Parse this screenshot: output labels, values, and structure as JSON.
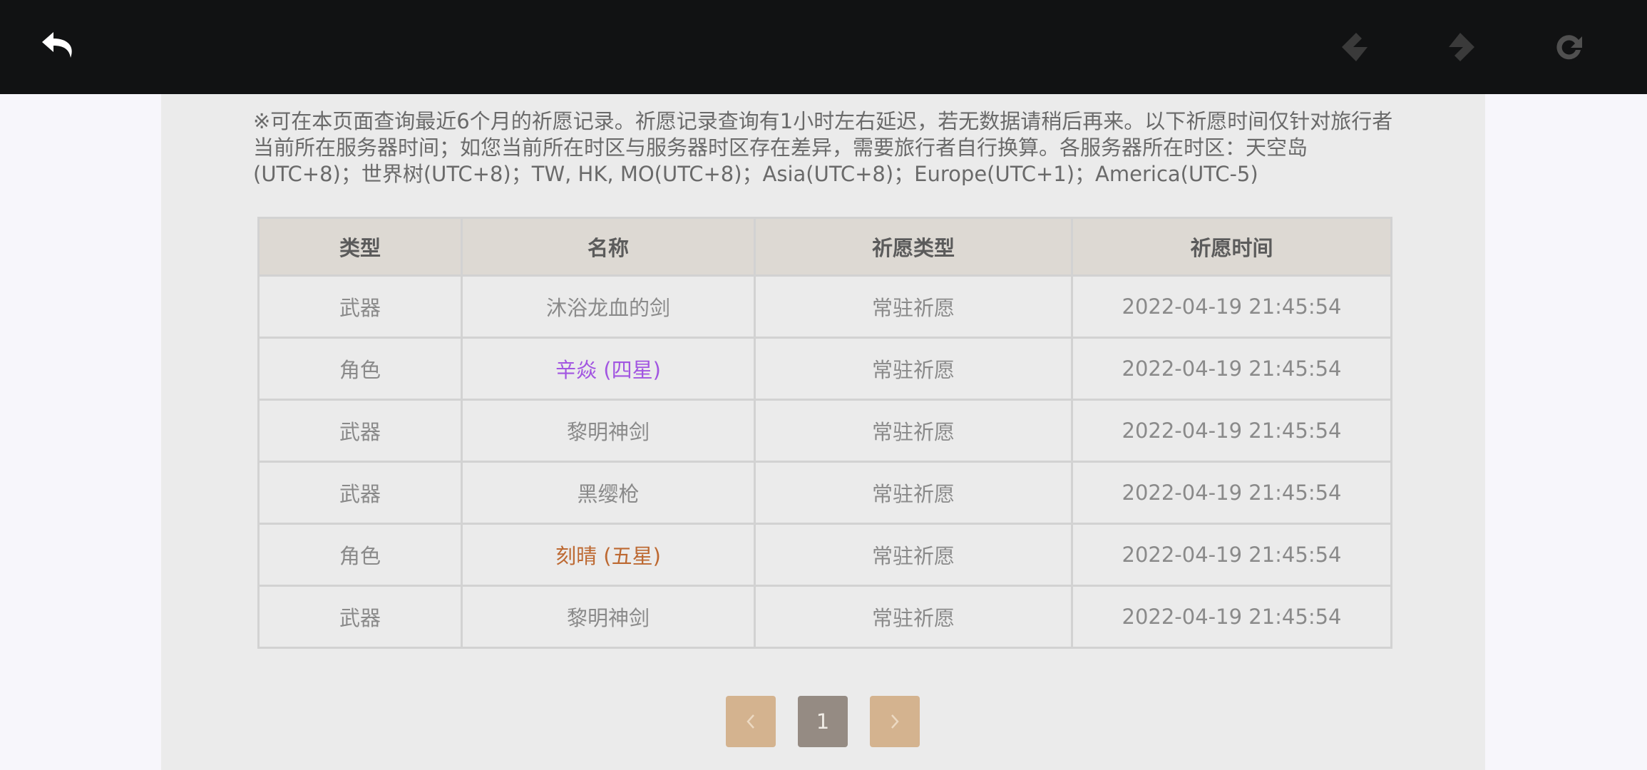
{
  "toolbar": {
    "back_icon": "undo-arrow-icon",
    "prev_icon": "back-diamond-icon",
    "next_icon": "forward-diamond-icon",
    "reload_icon": "reload-icon"
  },
  "notice": "※可在本页面查询最近6个月的祈愿记录。祈愿记录查询有1小时左右延迟，若无数据请稍后再来。以下祈愿时间仅针对旅行者当前所在服务器时间；如您当前所在时区与服务器时区存在差异，需要旅行者自行换算。各服务器所在时区：天空岛(UTC+8)；世界树(UTC+8)；TW, HK, MO(UTC+8)；Asia(UTC+8)；Europe(UTC+1)；America(UTC-5)",
  "table": {
    "headers": [
      "类型",
      "名称",
      "祈愿类型",
      "祈愿时间"
    ],
    "rows": [
      [
        "武器",
        "沐浴龙血的剑",
        "常驻祈愿",
        "2022-04-19 21:45:54"
      ],
      [
        "角色",
        "辛焱 (四星)",
        "常驻祈愿",
        "2022-04-19 21:45:54"
      ],
      [
        "武器",
        "黎明神剑",
        "常驻祈愿",
        "2022-04-19 21:45:54"
      ],
      [
        "武器",
        "黑缨枪",
        "常驻祈愿",
        "2022-04-19 21:45:54"
      ],
      [
        "角色",
        "刻晴 (五星)",
        "常驻祈愿",
        "2022-04-19 21:45:54"
      ],
      [
        "武器",
        "黎明神剑",
        "常驻祈愿",
        "2022-04-19 21:45:54"
      ]
    ]
  },
  "pagination": {
    "prev_icon": "chevron-left-icon",
    "current_page": "1",
    "next_icon": "chevron-right-icon"
  },
  "colors": {
    "four_star": "#a256e1",
    "five_star": "#bd6932",
    "header_bg": "#ddd9d3",
    "pager_active": "#958b83",
    "pager_arrow": "#d4b38f"
  }
}
